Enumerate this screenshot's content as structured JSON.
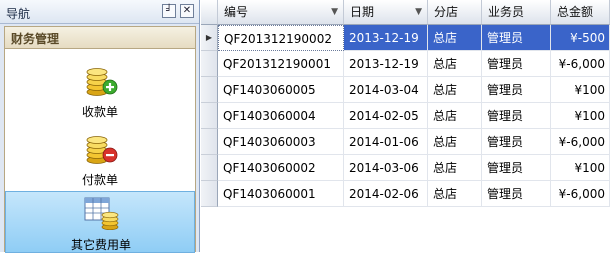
{
  "nav": {
    "title": "导航",
    "pin_label": "╛",
    "close_label": "✕",
    "group_title": "财务管理",
    "items": [
      {
        "label": "收款单"
      },
      {
        "label": "付款单"
      },
      {
        "label": "其它费用单"
      }
    ]
  },
  "grid": {
    "columns": [
      "编号",
      "日期",
      "分店",
      "业务员",
      "总金额"
    ],
    "rows": [
      {
        "code": "QF201312190002",
        "date": "2013-12-19",
        "branch": "总店",
        "staff": "管理员",
        "amount": "¥-500"
      },
      {
        "code": "QF201312190001",
        "date": "2013-12-19",
        "branch": "总店",
        "staff": "管理员",
        "amount": "¥-6,000"
      },
      {
        "code": "QF1403060005",
        "date": "2014-03-04",
        "branch": "总店",
        "staff": "管理员",
        "amount": "¥100"
      },
      {
        "code": "QF1403060004",
        "date": "2014-02-05",
        "branch": "总店",
        "staff": "管理员",
        "amount": "¥100"
      },
      {
        "code": "QF1403060003",
        "date": "2014-01-06",
        "branch": "总店",
        "staff": "管理员",
        "amount": "¥-6,000"
      },
      {
        "code": "QF1403060002",
        "date": "2014-03-06",
        "branch": "总店",
        "staff": "管理员",
        "amount": "¥100"
      },
      {
        "code": "QF1403060001",
        "date": "2014-02-06",
        "branch": "总店",
        "staff": "管理员",
        "amount": "¥-6,000"
      }
    ],
    "selected_row": 0
  },
  "colors": {
    "selection": "#3a64c9",
    "nav_selected": "#8fcdf5",
    "group_header": "#e6dcc2"
  }
}
